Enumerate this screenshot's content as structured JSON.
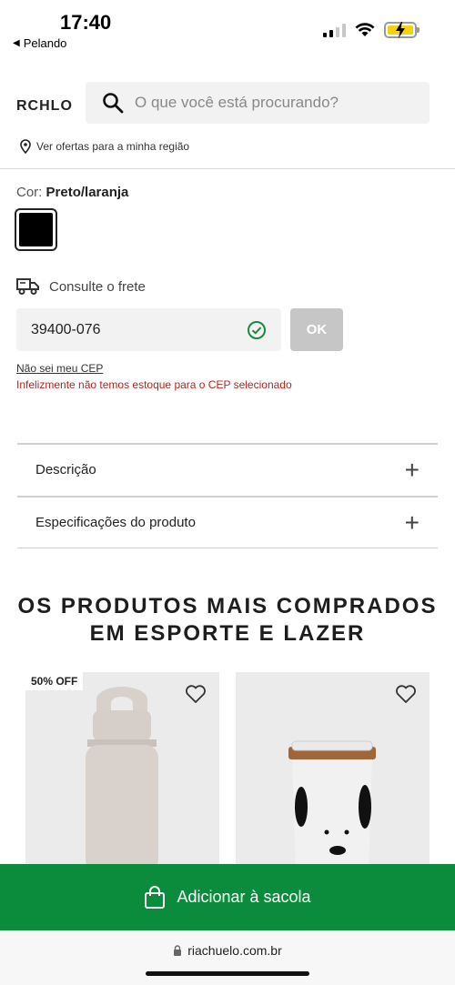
{
  "status": {
    "time": "17:40",
    "back_app": "Pelando"
  },
  "header": {
    "logo": "RCHLO",
    "search_placeholder": "O que você está procurando?",
    "region_link": "Ver ofertas para a minha região"
  },
  "color": {
    "label": "Cor:",
    "value": "Preto/laranja",
    "swatch_color": "#000000"
  },
  "freight": {
    "title": "Consulte o frete",
    "cep_value": "39400-076",
    "ok_label": "OK",
    "no_cep_link": "Não sei meu CEP",
    "error": "Infelizmente não temos estoque para o CEP selecionado"
  },
  "accordion": {
    "description": "Descrição",
    "specs": "Especificações do produto"
  },
  "section": {
    "title_line1": "OS PRODUTOS MAIS COMPRADOS",
    "title_line2": "EM ESPORTE E LAZER"
  },
  "products": [
    {
      "badge": "50% OFF"
    },
    {
      "badge": ""
    }
  ],
  "cta": {
    "label": "Adicionar à sacola",
    "color": "#0b8c3c"
  },
  "browser": {
    "url": "riachuelo.com.br"
  }
}
